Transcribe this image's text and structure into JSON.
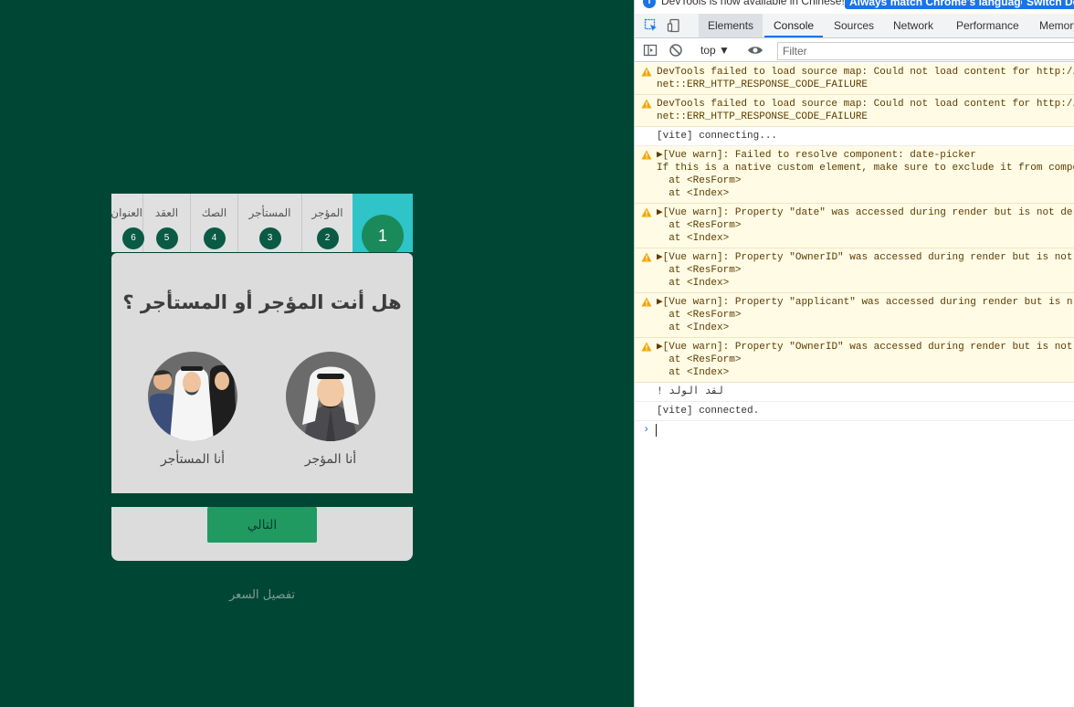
{
  "app": {
    "steps": [
      {
        "label": "المؤجر",
        "num": "2"
      },
      {
        "label": "المستأجر",
        "num": "3"
      },
      {
        "label": "الصك",
        "num": "4"
      },
      {
        "label": "العقد",
        "num": "5"
      },
      {
        "label": "العنوان",
        "num": "6"
      }
    ],
    "active_step": "1",
    "question": "هل أنت المؤجر أو المستأجر ؟",
    "owner_label": "أنا المؤجر",
    "tenant_label": "أنا المستأجر",
    "next_button": "التالي",
    "price_link": "تفصيل السعر",
    "colors": {
      "background": "#004634",
      "card": "#dcdcdc",
      "accent": "#219a62",
      "active_step": "#2ec4c8"
    }
  },
  "devtools": {
    "info_text": "DevTools is now available in Chinese!",
    "info_btn_1": "Always match Chrome's language",
    "info_btn_2": "Switch DevTools",
    "tabs": [
      "Elements",
      "Console",
      "Sources",
      "Network",
      "Performance",
      "Memory"
    ],
    "context": "top ▼",
    "filter_placeholder": "Filter",
    "messages": [
      {
        "type": "warn",
        "lines": [
          "DevTools failed to load source map: Could not load content for http://",
          "net::ERR_HTTP_RESPONSE_CODE_FAILURE"
        ]
      },
      {
        "type": "warn",
        "lines": [
          "DevTools failed to load source map: Could not load content for http://",
          "net::ERR_HTTP_RESPONSE_CODE_FAILURE"
        ]
      },
      {
        "type": "log",
        "lines": [
          "[vite] connecting..."
        ]
      },
      {
        "type": "warn",
        "lines": [
          "▶[Vue warn]: Failed to resolve component: date-picker",
          "If this is a native custom element, make sure to exclude it from compo",
          "  at <ResForm>",
          "  at <Index>"
        ]
      },
      {
        "type": "warn",
        "lines": [
          "▶[Vue warn]: Property \"date\" was accessed during render but is not de",
          "  at <ResForm>",
          "  at <Index>"
        ]
      },
      {
        "type": "warn",
        "lines": [
          "▶[Vue warn]: Property \"OwnerID\" was accessed during render but is not",
          "  at <ResForm>",
          "  at <Index>"
        ]
      },
      {
        "type": "warn",
        "lines": [
          "▶[Vue warn]: Property \"applicant\" was accessed during render but is n",
          "  at <ResForm>",
          "  at <Index>"
        ]
      },
      {
        "type": "warn",
        "lines": [
          "▶[Vue warn]: Property \"OwnerID\" was accessed during render but is not",
          "  at <ResForm>",
          "  at <Index>"
        ]
      },
      {
        "type": "log",
        "lines": [
          "لقد الولد !"
        ]
      },
      {
        "type": "log",
        "lines": [
          "[vite] connected."
        ]
      }
    ]
  }
}
